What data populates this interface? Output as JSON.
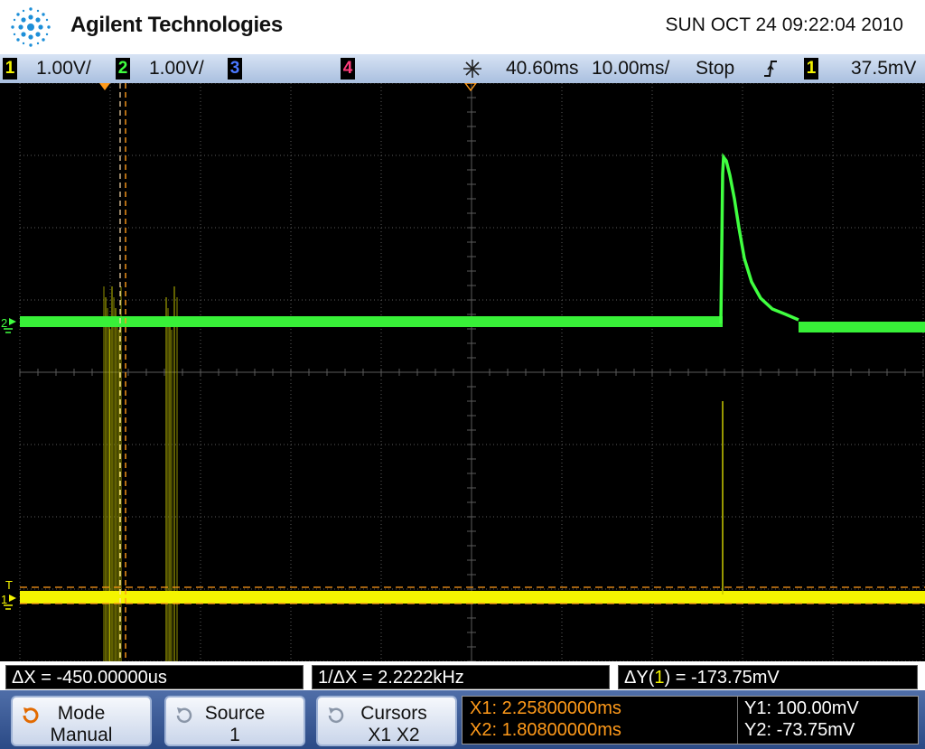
{
  "header": {
    "brand": "Agilent Technologies",
    "datetime": "SUN OCT 24 09:22:04 2010"
  },
  "status_bar": {
    "ch1": {
      "num": "1",
      "scale": "1.00V/",
      "color": "#f4f400"
    },
    "ch2": {
      "num": "2",
      "scale": "1.00V/",
      "color": "#40ff40"
    },
    "ch3": {
      "num": "3",
      "color": "#4a78ff"
    },
    "ch4": {
      "num": "4",
      "color": "#ff3c7a"
    },
    "delay": "40.60ms",
    "timebase": "10.00ms/",
    "run_state": "Stop",
    "trigger_source": "1",
    "trigger_level": "37.5mV"
  },
  "scope": {
    "ch2_marker": "2",
    "ch1_marker": "1",
    "trigger_marker": "T"
  },
  "measurements": {
    "delta_x": "ΔX = -450.00000us",
    "inv_delta_x": "1/ΔX = 2.2222kHz",
    "delta_y_prefix": "ΔY(",
    "delta_y_ch": "1",
    "delta_y_suffix": ") = -173.75mV"
  },
  "softkeys": {
    "mode": {
      "title": "Mode",
      "value": "Manual"
    },
    "source": {
      "title": "Source",
      "value": "1"
    },
    "cursors": {
      "title": "Cursors",
      "value": "X1 X2"
    }
  },
  "cursor_readout": {
    "x1": "X1: 2.25800000ms",
    "x2": "X2: 1.80800000ms",
    "y1": "Y1: 100.00mV",
    "y2": "Y2: -73.75mV"
  },
  "colors": {
    "ch1": "#f4f400",
    "ch2": "#40ff40",
    "cursor_orange": "#ff9a1a",
    "grid": "#5a5a5a"
  },
  "icons": [
    "agilent-spark-logo",
    "acquire-spark-icon",
    "rising-edge-trigger-icon",
    "rotate-knob-icon"
  ]
}
